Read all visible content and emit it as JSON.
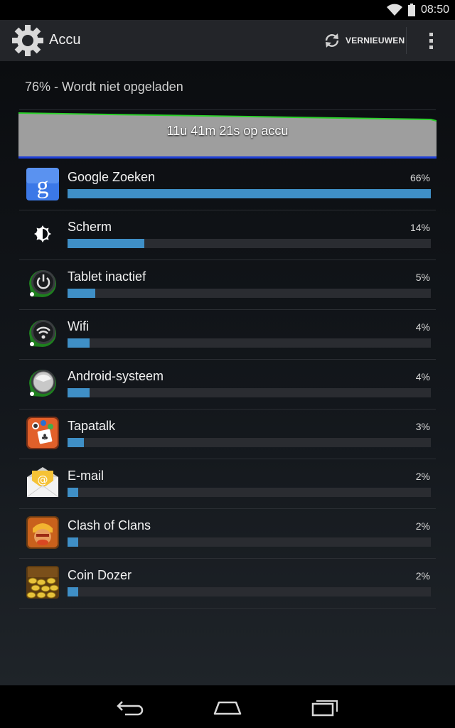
{
  "status_bar": {
    "time": "08:50",
    "icons": [
      "wifi-icon",
      "battery-icon"
    ]
  },
  "action_bar": {
    "title": "Accu",
    "app_icon": "gear-icon",
    "refresh_label": "VERNIEUWEN",
    "refresh_icon": "refresh-icon",
    "overflow_icon": "overflow-menu-icon"
  },
  "battery": {
    "status": "76% - Wordt niet opgeladen",
    "graph_label": "11u 41m 21s op accu",
    "graph_fill_color": "#9e9e9e",
    "graph_line_color": "#2bd02b",
    "graph_base_color": "#1f3fd6"
  },
  "apps": [
    {
      "name": "Google Zoeken",
      "percent_label": "66%",
      "percent": 66,
      "icon": "google-search-icon"
    },
    {
      "name": "Scherm",
      "percent_label": "14%",
      "percent": 14,
      "icon": "brightness-icon"
    },
    {
      "name": "Tablet inactief",
      "percent_label": "5%",
      "percent": 5,
      "icon": "power-icon"
    },
    {
      "name": "Wifi",
      "percent_label": "4%",
      "percent": 4,
      "icon": "wifi-icon"
    },
    {
      "name": "Android-systeem",
      "percent_label": "4%",
      "percent": 4,
      "icon": "android-system-icon"
    },
    {
      "name": "Tapatalk",
      "percent_label": "3%",
      "percent": 3,
      "icon": "tapatalk-icon"
    },
    {
      "name": "E-mail",
      "percent_label": "2%",
      "percent": 2,
      "icon": "email-icon"
    },
    {
      "name": "Clash of Clans",
      "percent_label": "2%",
      "percent": 2,
      "icon": "clash-of-clans-icon"
    },
    {
      "name": "Coin Dozer",
      "percent_label": "2%",
      "percent": 2,
      "icon": "coin-dozer-icon"
    }
  ],
  "bar_color": "#3f8fc6",
  "nav": {
    "buttons": [
      "back-icon",
      "home-icon",
      "recent-apps-icon"
    ]
  }
}
